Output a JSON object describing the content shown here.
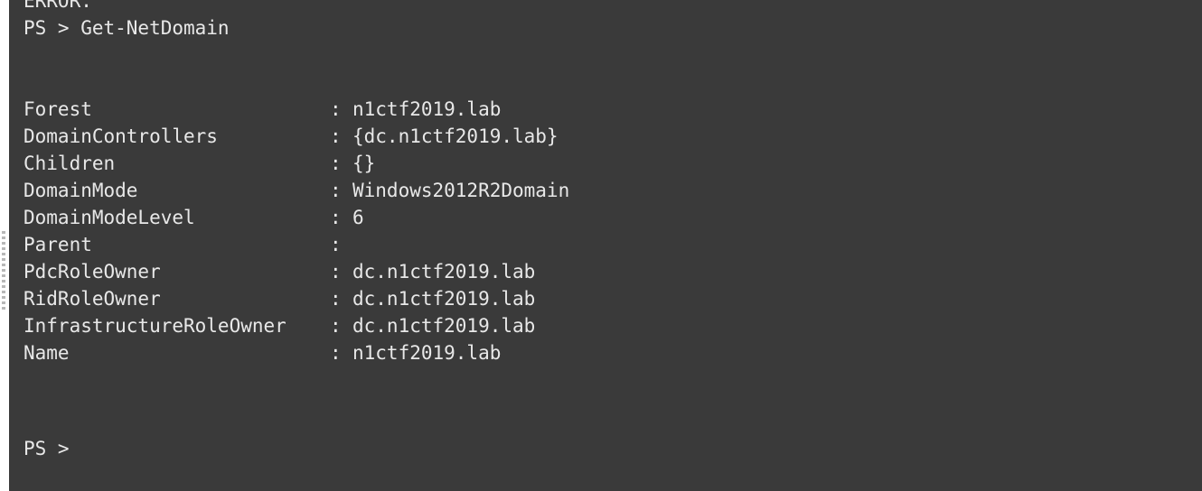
{
  "terminal": {
    "cut_line": "ERROR:",
    "command_line": "PS > Get-NetDomain",
    "separator": ":",
    "rows": [
      {
        "key": "Forest",
        "value": "n1ctf2019.lab"
      },
      {
        "key": "DomainControllers",
        "value": "{dc.n1ctf2019.lab}"
      },
      {
        "key": "Children",
        "value": "{}"
      },
      {
        "key": "DomainMode",
        "value": "Windows2012R2Domain"
      },
      {
        "key": "DomainModeLevel",
        "value": "6"
      },
      {
        "key": "Parent",
        "value": ""
      },
      {
        "key": "PdcRoleOwner",
        "value": "dc.n1ctf2019.lab"
      },
      {
        "key": "RidRoleOwner",
        "value": "dc.n1ctf2019.lab"
      },
      {
        "key": "InfrastructureRoleOwner",
        "value": "dc.n1ctf2019.lab"
      },
      {
        "key": "Name",
        "value": "n1ctf2019.lab"
      }
    ],
    "prompt": "PS >"
  }
}
